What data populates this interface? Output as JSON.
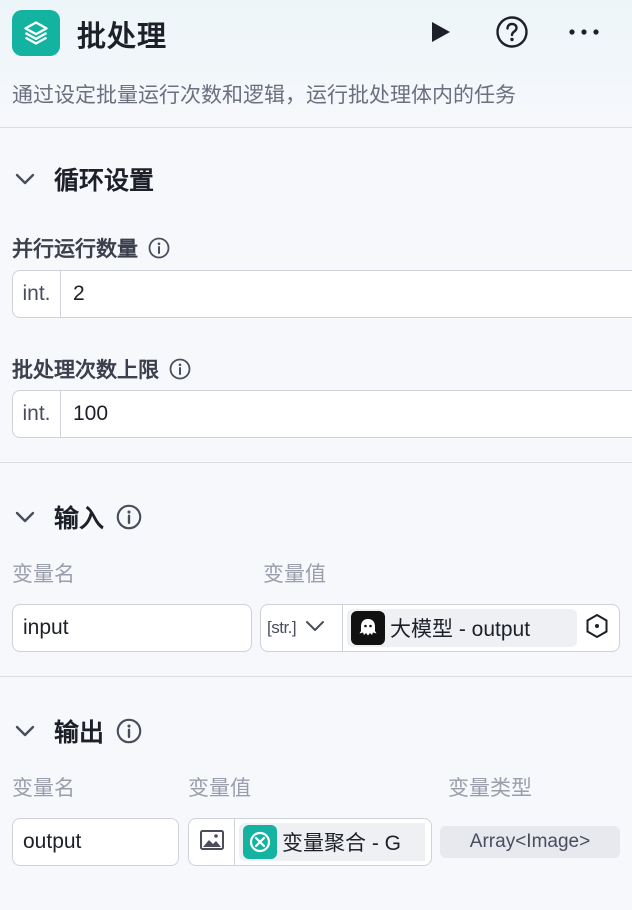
{
  "header": {
    "title": "批处理",
    "description": "通过设定批量运行次数和逻辑，运行批处理体内的任务",
    "icons": [
      "layers-icon",
      "play-icon",
      "help-icon",
      "more-icon"
    ]
  },
  "loop_settings": {
    "title": "循环设置",
    "concurrency": {
      "label": "并行运行数量",
      "prefix": "int.",
      "value": "2"
    },
    "batch_limit": {
      "label": "批处理次数上限",
      "prefix": "int.",
      "value": "100"
    }
  },
  "input": {
    "title": "输入",
    "col_name": "变量名",
    "col_value": "变量值",
    "row": {
      "name": "input",
      "type_prefix": "[str.]",
      "ref": "大模型 - output"
    }
  },
  "output": {
    "title": "输出",
    "col_name": "变量名",
    "col_value": "变量值",
    "col_type": "变量类型",
    "row": {
      "name": "output",
      "ref": "变量聚合 - G",
      "type": "Array<Image>"
    }
  },
  "colors": {
    "accent": "#14b3a1",
    "text": "#1d1f29",
    "muted": "#9a9eab"
  }
}
